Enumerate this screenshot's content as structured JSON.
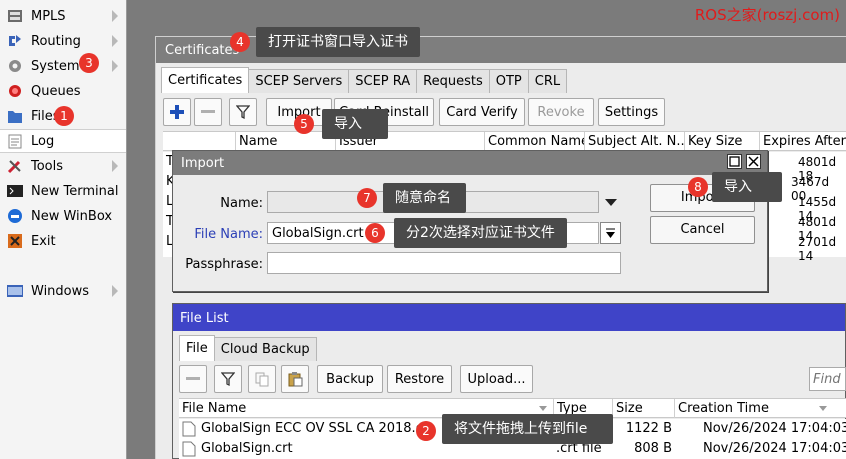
{
  "menu": {
    "items": [
      {
        "label": "MPLS",
        "icon": "mpls-icon",
        "arrow": true
      },
      {
        "label": "Routing",
        "icon": "routing-icon",
        "arrow": true
      },
      {
        "label": "System",
        "icon": "gear-icon",
        "arrow": true
      },
      {
        "label": "Queues",
        "icon": "queues-icon",
        "arrow": false
      },
      {
        "label": "Files",
        "icon": "files-icon",
        "arrow": false
      },
      {
        "label": "Log",
        "icon": "log-icon",
        "arrow": false
      },
      {
        "label": "Tools",
        "icon": "tools-icon",
        "arrow": true
      },
      {
        "label": "New Terminal",
        "icon": "terminal-icon",
        "arrow": false
      },
      {
        "label": "New WinBox",
        "icon": "winbox-icon",
        "arrow": false
      },
      {
        "label": "Exit",
        "icon": "exit-icon",
        "arrow": false
      },
      {
        "label": "Windows",
        "icon": "windows-icon",
        "arrow": true
      }
    ]
  },
  "watermark": "ROS之家(roszj.com)",
  "certificates": {
    "title": "Certificates",
    "tabs": [
      "Certificates",
      "SCEP Servers",
      "SCEP RA",
      "Requests",
      "OTP",
      "CRL"
    ],
    "toolbar": {
      "import_label": "Import",
      "card_reinstall_label": "Card Reinstall",
      "card_verify_label": "Card Verify",
      "revoke_label": "Revoke",
      "settings_label": "Settings"
    },
    "columns": [
      "Name",
      "Issuer",
      "Common Name",
      "Subject Alt. N...",
      "Key Size",
      "Expires After"
    ],
    "rows": [
      {
        "lead": "T",
        "expires": "4801d 18"
      },
      {
        "lead": "K",
        "expires": "3467d 00"
      },
      {
        "lead": "L",
        "expires": "1455d 14"
      },
      {
        "lead": "T",
        "expires": "4801d 14"
      },
      {
        "lead": "L",
        "expires": "2701d 14"
      }
    ]
  },
  "import_dialog": {
    "title": "Import",
    "name_label": "Name:",
    "name_value": "",
    "file_name_label": "File Name:",
    "file_name_value": "GlobalSign.crt",
    "passphrase_label": "Passphrase:",
    "passphrase_value": "",
    "import_button": "Import",
    "cancel_button": "Cancel"
  },
  "file_list": {
    "title": "File List",
    "tabs": [
      "File",
      "Cloud Backup"
    ],
    "toolbar": {
      "backup_label": "Backup",
      "restore_label": "Restore",
      "upload_label": "Upload...",
      "find_placeholder": "Find"
    },
    "columns": [
      "File Name",
      "Type",
      "Size",
      "Creation Time"
    ],
    "rows": [
      {
        "name": "GlobalSign ECC OV SSL CA 2018.crt",
        "type": ".crt file",
        "size": "1122 B",
        "created": "Nov/26/2024 17:04:03"
      },
      {
        "name": "GlobalSign.crt",
        "type": ".crt file",
        "size": "808 B",
        "created": "Nov/26/2024 17:04:03"
      }
    ]
  },
  "annotations": [
    {
      "num": "1",
      "text": ""
    },
    {
      "num": "2",
      "text": "将文件拖拽上传到file"
    },
    {
      "num": "3",
      "text": ""
    },
    {
      "num": "4",
      "text": "打开证书窗口导入证书"
    },
    {
      "num": "5",
      "text": "导入"
    },
    {
      "num": "6",
      "text": "分2次选择对应证书文件"
    },
    {
      "num": "7",
      "text": "随意命名"
    },
    {
      "num": "8",
      "text": "导入"
    }
  ],
  "colors": {
    "badge": "#e8342b",
    "callout": "#4a4a4a",
    "filelist_title": "#3f44c8",
    "watermark": "#e01b1b"
  }
}
